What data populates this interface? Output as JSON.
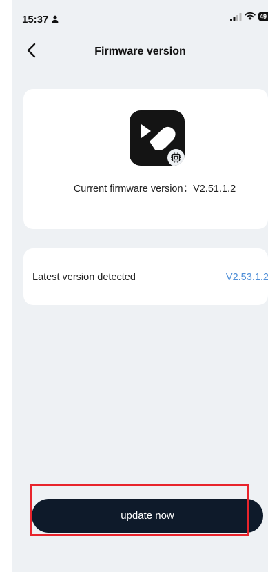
{
  "status_bar": {
    "time": "15:37",
    "battery_text": "49"
  },
  "header": {
    "title": "Firmware version"
  },
  "current_card": {
    "label": "Current firmware version：V2.51.1.2"
  },
  "latest_card": {
    "label": "Latest version detected",
    "version": "V2.53.1.2"
  },
  "actions": {
    "update_label": "update now"
  },
  "colors": {
    "background": "#eef1f4",
    "card": "#ffffff",
    "button": "#0e1a2a",
    "link_blue": "#4f8fd8",
    "highlight": "#e8242c"
  },
  "icons": [
    "person-icon",
    "signal-icon",
    "wifi-icon",
    "battery-icon",
    "back-icon",
    "app-logo-icon",
    "chip-icon"
  ]
}
